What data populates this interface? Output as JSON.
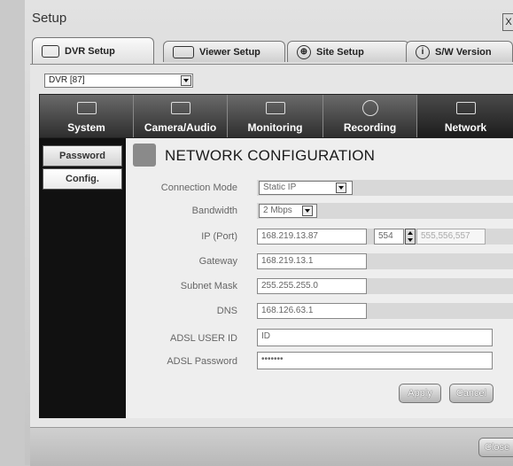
{
  "window": {
    "title": "Setup",
    "close_glyph": "X"
  },
  "tabs": [
    {
      "label": "DVR Setup",
      "icon": "dvr-icon",
      "active": true
    },
    {
      "label": "Viewer Setup",
      "icon": "viewer-icon",
      "active": false
    },
    {
      "label": "Site Setup",
      "icon": "globe-icon",
      "active": false
    },
    {
      "label": "S/W Version",
      "icon": "info-icon",
      "active": false
    }
  ],
  "dvr_select": {
    "value": "DVR [87]"
  },
  "categories": [
    {
      "label": "System",
      "icon": "system-icon"
    },
    {
      "label": "Camera/Audio",
      "icon": "camera-audio-icon"
    },
    {
      "label": "Monitoring",
      "icon": "monitor-icon"
    },
    {
      "label": "Recording",
      "icon": "recording-icon"
    },
    {
      "label": "Network",
      "icon": "network-icon",
      "active": true
    }
  ],
  "sidebar": {
    "items": [
      {
        "label": "Password"
      },
      {
        "label": "Config."
      }
    ]
  },
  "network": {
    "title": "NETWORK CONFIGURATION",
    "connection_mode": {
      "label": "Connection Mode",
      "value": "Static IP"
    },
    "bandwidth": {
      "label": "Bandwidth",
      "value": "2 Mbps"
    },
    "ip_port": {
      "label": "IP (Port)",
      "ip": "168.219.13.87",
      "port": "554",
      "ports_extra": "555,556,557"
    },
    "gateway": {
      "label": "Gateway",
      "value": "168.219.13.1"
    },
    "subnet": {
      "label": "Subnet Mask",
      "value": "255.255.255.0"
    },
    "dns": {
      "label": "DNS",
      "value": "168.126.63.1"
    },
    "adsl_user": {
      "label": "ADSL USER ID",
      "value": "ID"
    },
    "adsl_password": {
      "label": "ADSL Password",
      "value": "•••••••"
    }
  },
  "buttons": {
    "apply": "Apply",
    "cancel": "Cancel",
    "close": "Close"
  }
}
